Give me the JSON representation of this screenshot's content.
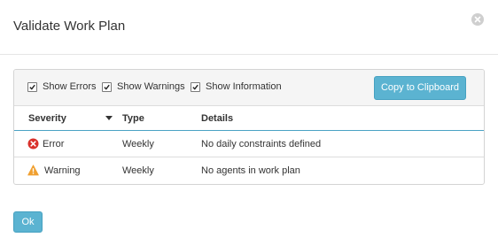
{
  "dialog": {
    "title": "Validate Work Plan",
    "close_icon": "close-circle-icon"
  },
  "toolbar": {
    "filters": [
      {
        "label": "Show Errors",
        "checked": true
      },
      {
        "label": "Show Warnings",
        "checked": true
      },
      {
        "label": "Show Information",
        "checked": true
      }
    ],
    "copy_label": "Copy to Clipboard"
  },
  "table": {
    "columns": [
      "Severity",
      "Type",
      "Details"
    ],
    "sort_icon": "sort-down-icon",
    "rows": [
      {
        "severity": "Error",
        "severity_icon": "error-icon",
        "type": "Weekly",
        "details": "No daily constraints defined"
      },
      {
        "severity": "Warning",
        "severity_icon": "warning-icon",
        "type": "Weekly",
        "details": "No agents in work plan"
      }
    ]
  },
  "footer": {
    "ok_label": "Ok"
  },
  "colors": {
    "primary_button": "#5bb3d1",
    "error": "#d9312b",
    "warning": "#f0a030",
    "header_underline": "#4aa3c4"
  }
}
